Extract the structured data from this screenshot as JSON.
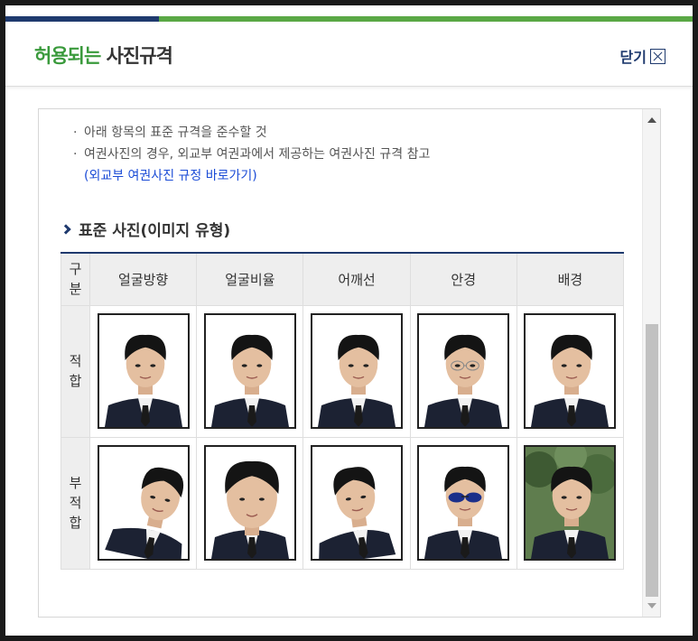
{
  "modal": {
    "title_highlight": "허용되는",
    "title_rest": " 사진규격",
    "close_label": "닫기",
    "colors": {
      "navy": "#1f3a6e",
      "green": "#5aa845",
      "title_green": "#3a9a3c",
      "link": "#1a4bd6"
    }
  },
  "bullets": {
    "line1": "아래 항목의 표준 규격을 준수할 것",
    "line2": "여권사진의 경우, 외교부 여권과에서 제공하는 여권사진 규격 참고",
    "link": "(외교부 여권사진 규정 바로가기)"
  },
  "section": {
    "title": "표준 사진(이미지 유형)"
  },
  "table": {
    "corner_header": "구\n분",
    "columns": [
      "얼굴방향",
      "얼굴비율",
      "어깨선",
      "안경",
      "배경"
    ],
    "rows": [
      {
        "label": "적\n합",
        "photos": [
          "suitable-face-direction",
          "suitable-face-ratio",
          "suitable-shoulder-line",
          "suitable-glasses",
          "suitable-background"
        ]
      },
      {
        "label": "부\n적\n합",
        "photos": [
          "unsuitable-face-direction",
          "unsuitable-face-ratio",
          "unsuitable-shoulder-line",
          "unsuitable-glasses",
          "unsuitable-background"
        ]
      }
    ]
  },
  "icons": [
    "close-x-icon",
    "chevron-right-icon",
    "scroll-up-arrow-icon",
    "scroll-down-arrow-icon"
  ]
}
